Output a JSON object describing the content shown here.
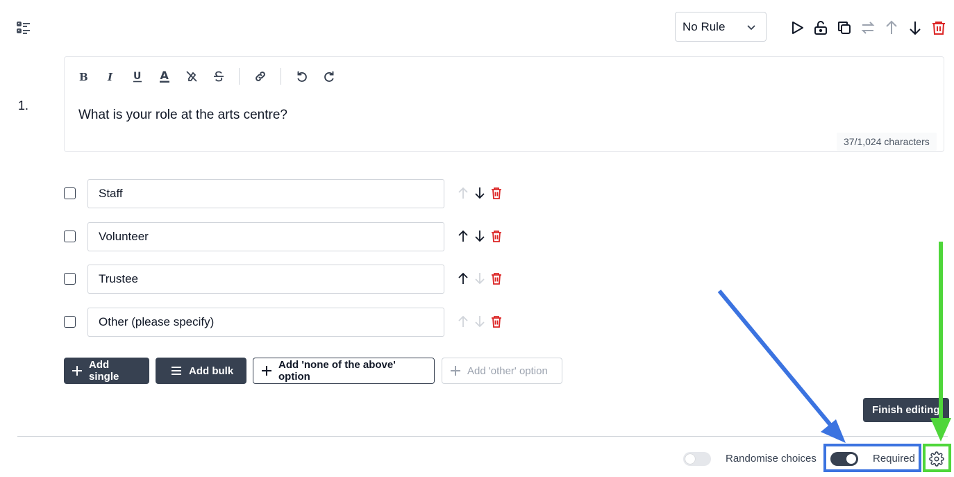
{
  "header": {
    "rule_select": {
      "value": "No Rule"
    },
    "icons": [
      "play-icon",
      "unlock-icon",
      "duplicate-icon",
      "swap-icon",
      "arrow-up-icon",
      "arrow-down-icon",
      "trash-icon"
    ]
  },
  "question": {
    "number": "1.",
    "text": "What is your role at the arts centre?",
    "char_count": "37/1,024 characters",
    "format_tools": [
      "bold",
      "italic",
      "underline",
      "text-color",
      "highlight-off",
      "strikethrough",
      "link",
      "undo",
      "redo"
    ]
  },
  "choices": [
    {
      "label": "Staff",
      "up_enabled": false,
      "down_enabled": true
    },
    {
      "label": "Volunteer",
      "up_enabled": true,
      "down_enabled": true
    },
    {
      "label": "Trustee",
      "up_enabled": true,
      "down_enabled": false
    },
    {
      "label": "Other (please specify)",
      "up_enabled": false,
      "down_enabled": false
    }
  ],
  "buttons": {
    "add_single": "Add single",
    "add_bulk": "Add bulk",
    "add_none": "Add 'none of the above' option",
    "add_other": "Add 'other' option"
  },
  "tooltip": "Finish editing",
  "footer": {
    "randomise_label": "Randomise choices",
    "randomise_on": false,
    "required_label": "Required",
    "required_on": true
  },
  "colors": {
    "dark": "#374151",
    "danger": "#dc2626",
    "annotation_blue": "#3b73e0",
    "annotation_green": "#4fd63a"
  }
}
